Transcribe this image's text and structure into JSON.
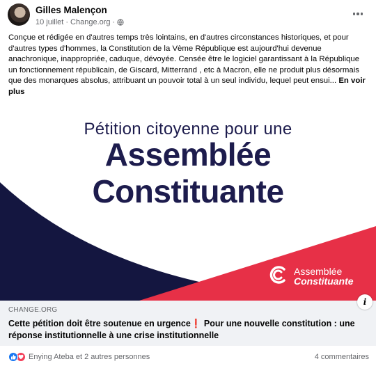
{
  "post": {
    "author": "Gilles Malençon",
    "date": "10 juillet",
    "separator": "·",
    "source": "Change.org",
    "text": "Conçue et rédigée en d'autres temps très lointains, en d'autres circonstances historiques, et pour d'autres types d'hommes,  la Constitution de la Vème République est aujourd'hui devenue anachronique, inappropriée, caduque, dévoyée. Censée être le logiciel garantissant à la République un fonctionnement républicain, de Giscard, Mitterrand , etc à Macron, elle ne produit plus désormais que des monarques absolus, attribuant un pouvoir total à un seul individu, lequel peut ensui...",
    "see_more": "En voir plus"
  },
  "image": {
    "subtitle": "Pétition citoyenne pour une",
    "title_line1": "Assemblée",
    "title_line2": "Constituante",
    "logo_line1": "Assemblée",
    "logo_line2": "Constituante",
    "colors": {
      "navy": "#1d1c4d",
      "red": "#e73047"
    }
  },
  "link": {
    "domain": "CHANGE.ORG",
    "title": "Cette pétition doit être soutenue en urgence❗ Pour une nouvelle constitution : une réponse institutionnelle à une crise institutionnelle"
  },
  "footer": {
    "reactions_text": "Enying Ateba et 2 autres personnes",
    "comments": "4 commentaires"
  },
  "icons": [
    "globe-icon",
    "more-options-icon",
    "info-icon",
    "like-reaction-icon",
    "love-reaction-icon"
  ]
}
